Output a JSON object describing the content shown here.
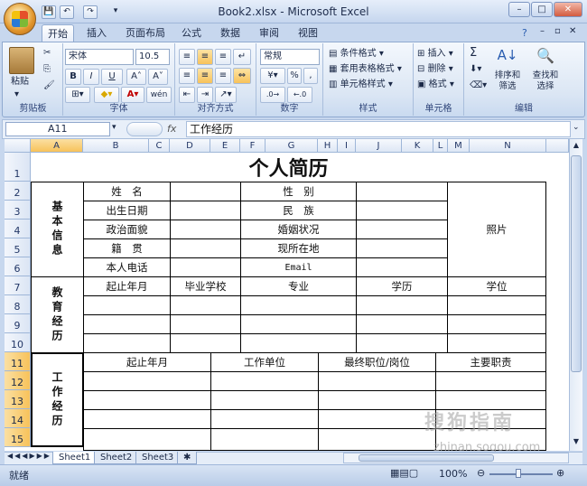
{
  "window": {
    "title": "Book2.xlsx - Microsoft Excel",
    "min": "–",
    "max": "□",
    "close": "✕"
  },
  "quick_access": {
    "save": "💾",
    "undo": "↶",
    "redo": "↷",
    "more": "▾"
  },
  "tabs": [
    "开始",
    "插入",
    "页面布局",
    "公式",
    "数据",
    "审阅",
    "视图"
  ],
  "ribbon": {
    "clipboard": {
      "label": "剪贴板",
      "paste": "粘贴"
    },
    "font": {
      "label": "字体",
      "name": "宋体",
      "size": "10.5",
      "bold": "B",
      "italic": "I",
      "underline": "U",
      "grow": "A˄",
      "shrink": "A˅",
      "wen": "wén"
    },
    "align": {
      "label": "对齐方式"
    },
    "number": {
      "label": "数字",
      "format": "常规",
      "percent": "%",
      "comma": ","
    },
    "styles": {
      "label": "样式",
      "cond": "条件格式",
      "table": "套用表格格式",
      "cell": "单元格样式"
    },
    "cells": {
      "label": "单元格",
      "insert": "插入",
      "delete": "删除",
      "format": "格式"
    },
    "edit": {
      "label": "编辑",
      "sort": "排序和\n筛选",
      "find": "查找和\n选择",
      "sigma": "Σ"
    }
  },
  "formula_bar": {
    "name_box": "A11",
    "fx": "fx",
    "value": "工作经历"
  },
  "columns": [
    "A",
    "B",
    "C",
    "D",
    "E",
    "F",
    "G",
    "H",
    "I",
    "J",
    "K",
    "L",
    "M",
    "N"
  ],
  "rows": [
    "1",
    "2",
    "3",
    "4",
    "5",
    "6",
    "7",
    "8",
    "9",
    "10",
    "11",
    "12",
    "13",
    "14",
    "15"
  ],
  "resume": {
    "title": "个人简历",
    "basic_section": "基本信息",
    "basic_fields": [
      "姓　名",
      "出生日期",
      "政治面貌",
      "籍　贯",
      "本人电话"
    ],
    "basic_fields_right": [
      "性　别",
      "民　族",
      "婚姻状况",
      "现所在地",
      "Email"
    ],
    "photo": "照片",
    "edu_section": "教育经历",
    "edu_headers": [
      "起止年月",
      "毕业学校",
      "专业",
      "学历",
      "学位"
    ],
    "work_section": "工作经历",
    "work_headers": [
      "起止年月",
      "工作单位",
      "最终职位/岗位",
      "主要职责"
    ]
  },
  "sheets": [
    "Sheet1",
    "Sheet2",
    "Sheet3"
  ],
  "status": {
    "ready": "就绪",
    "zoom": "100%"
  },
  "watermark": {
    "text": "搜狗指南",
    "url": "zhinan.sogou.com"
  }
}
